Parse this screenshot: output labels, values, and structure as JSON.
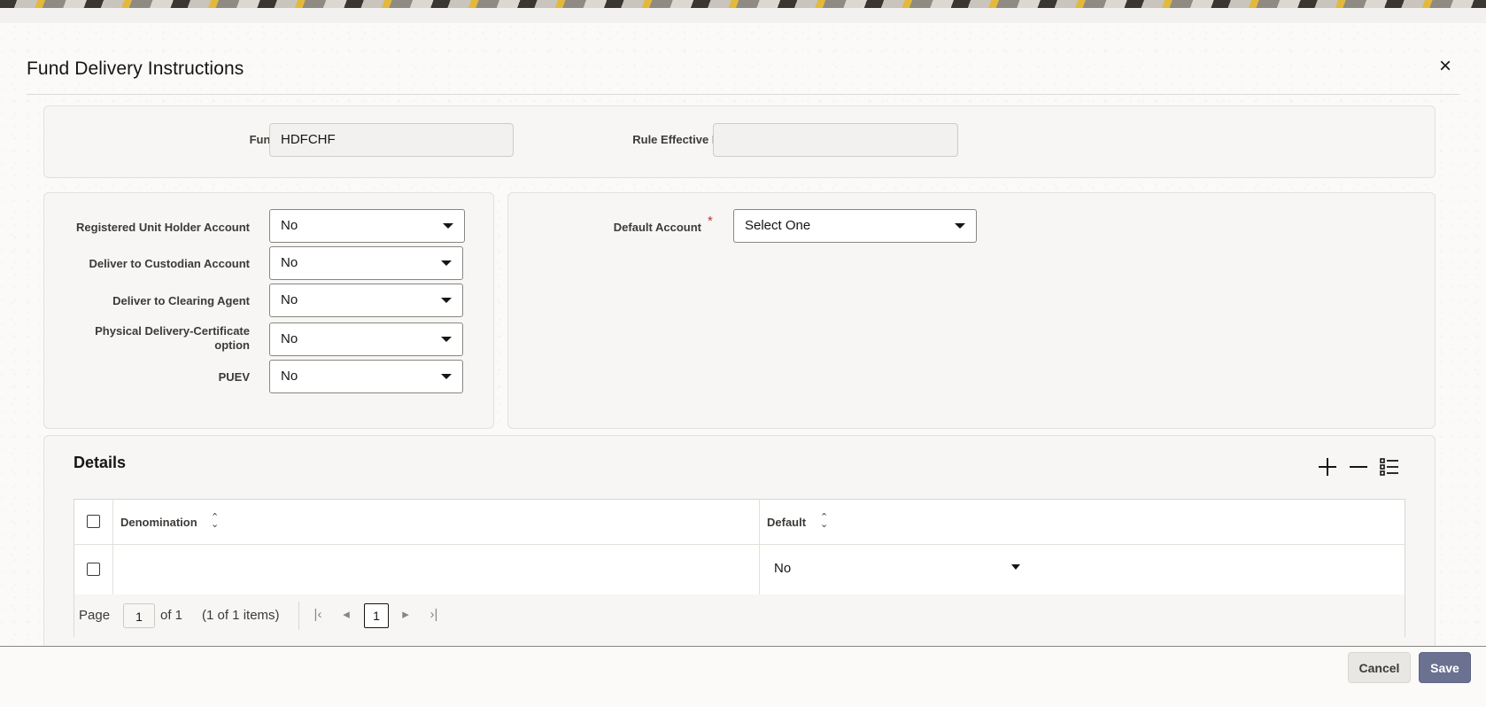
{
  "dialog": {
    "title": "Fund Delivery Instructions",
    "close_icon": "×"
  },
  "header_panel": {
    "fund_id_label": "Fund ID",
    "fund_id_value": "HDFCHF",
    "rule_effective_date_label": "Rule Effective Date",
    "rule_effective_date_value": ""
  },
  "options_panel": {
    "items": [
      {
        "label": "Registered Unit Holder Account",
        "value": "No"
      },
      {
        "label": "Deliver to Custodian Account",
        "value": "No"
      },
      {
        "label": "Deliver to Clearing Agent",
        "value": "No"
      },
      {
        "label_line1": "Physical Delivery-Certificate",
        "label_line2": "option",
        "value": "No"
      },
      {
        "label": "PUEV",
        "value": "No"
      }
    ]
  },
  "default_panel": {
    "label": "Default Account",
    "required_mark": "*",
    "value": "Select One"
  },
  "details": {
    "title": "Details",
    "columns": [
      "Denomination",
      "Default"
    ],
    "sort_icon": "⌃⌄",
    "rows": [
      {
        "denomination": "",
        "default": "No"
      }
    ],
    "pager": {
      "page_label": "Page",
      "page_value": "1",
      "of_label": "of 1",
      "items_label": "(1 of 1 items)",
      "current_page": "1"
    }
  },
  "footer": {
    "cancel_label": "Cancel",
    "save_label": "Save"
  },
  "colors": {
    "accent": "#6b7190",
    "required": "#c0392b"
  }
}
